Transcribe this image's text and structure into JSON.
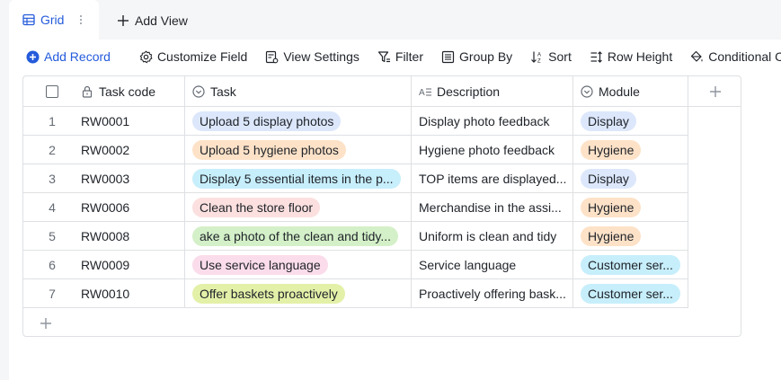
{
  "tabs": {
    "active_label": "Grid",
    "add_view_label": "Add View"
  },
  "toolbar": {
    "add_record": "Add Record",
    "customize_field": "Customize Field",
    "view_settings": "View Settings",
    "filter": "Filter",
    "group_by": "Group By",
    "sort": "Sort",
    "row_height": "Row Height",
    "conditional_coloring": "Conditional Colo"
  },
  "colors": {
    "accent": "#245bdb",
    "border": "#dee0e3",
    "pill_blue": "#dce7fb",
    "pill_orange": "#fde2c8",
    "pill_cyan": "#c7eefb",
    "pill_red": "#fbe0df",
    "pill_green": "#d4f0c8",
    "pill_pink": "#fbdcea",
    "pill_lime": "#e3f0a8"
  },
  "grid": {
    "headers": {
      "task_code": "Task code",
      "task": "Task",
      "description": "Description",
      "module": "Module"
    },
    "rows": [
      {
        "index": "1",
        "code": "RW0001",
        "task": "Upload 5 display photos",
        "task_color": "#dce7fb",
        "description": "Display photo feedback",
        "module": "Display",
        "module_color": "#dce7fb"
      },
      {
        "index": "2",
        "code": "RW0002",
        "task": "Upload 5 hygiene photos",
        "task_color": "#fde2c8",
        "description": "Hygiene photo feedback",
        "module": "Hygiene",
        "module_color": "#fde2c8"
      },
      {
        "index": "3",
        "code": "RW0003",
        "task": "Display 5 essential items in the p...",
        "task_color": "#c7eefb",
        "description": "TOP items are displayed...",
        "module": "Display",
        "module_color": "#dce7fb"
      },
      {
        "index": "4",
        "code": "RW0006",
        "task": "Clean the store floor",
        "task_color": "#fbe0df",
        "description": "Merchandise in the assi...",
        "module": "Hygiene",
        "module_color": "#fde2c8"
      },
      {
        "index": "5",
        "code": "RW0008",
        "task": "ake a photo of the clean and tidy...",
        "task_color": "#d4f0c8",
        "description": "Uniform is clean and tidy",
        "module": "Hygiene",
        "module_color": "#fde2c8"
      },
      {
        "index": "6",
        "code": "RW0009",
        "task": "Use service language",
        "task_color": "#fbdcea",
        "description": "Service language",
        "module": "Customer ser...",
        "module_color": "#c7eefb"
      },
      {
        "index": "7",
        "code": "RW0010",
        "task": "Offer baskets proactively",
        "task_color": "#e3f0a8",
        "description": "Proactively offering bask...",
        "module": "Customer ser...",
        "module_color": "#c7eefb"
      }
    ]
  }
}
